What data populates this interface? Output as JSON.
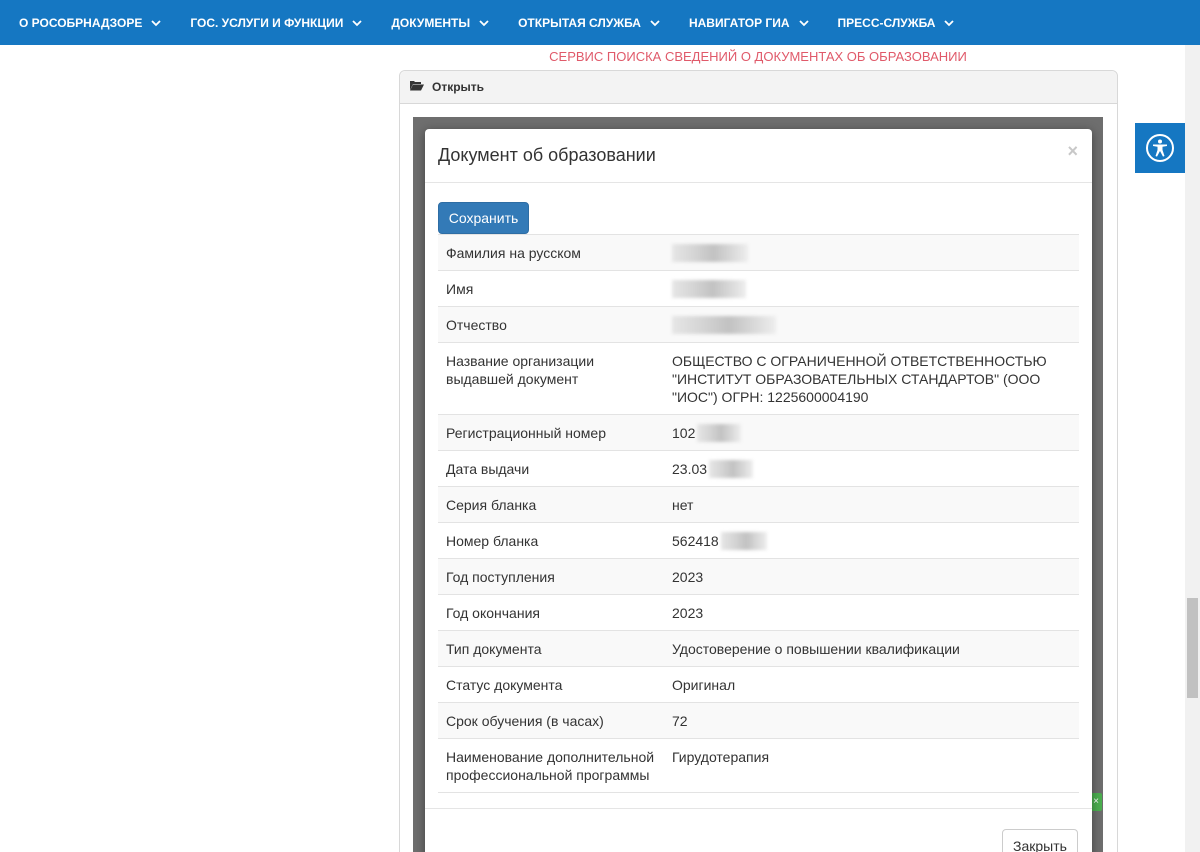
{
  "nav": {
    "items": [
      {
        "label": "О РОСОБРНАДЗОРЕ"
      },
      {
        "label": "ГОС. УСЛУГИ И ФУНКЦИИ"
      },
      {
        "label": "ДОКУМЕНТЫ"
      },
      {
        "label": "ОТКРЫТАЯ СЛУЖБА"
      },
      {
        "label": "НАВИГАТОР ГИА"
      },
      {
        "label": "ПРЕСС-СЛУЖБА"
      }
    ]
  },
  "service_title": "СЕРВИС ПОИСКА СВЕДЕНИЙ О ДОКУМЕНТАХ ОБ ОБРАЗОВАНИИ",
  "panel": {
    "open_label": "Открыть"
  },
  "modal": {
    "title": "Документ об образовании",
    "close_symbol": "×",
    "save_label": "Сохранить",
    "close_label": "Закрыть",
    "rows": [
      {
        "label": "Фамилия на русском",
        "value": ""
      },
      {
        "label": "Имя",
        "value": ""
      },
      {
        "label": "Отчество",
        "value": ""
      },
      {
        "label": "Название организации выдавшей документ",
        "value": "ОБЩЕСТВО С ОГРАНИЧЕННОЙ ОТВЕТСТВЕННОСТЬЮ \"ИНСТИТУТ ОБРАЗОВАТЕЛЬНЫХ СТАНДАРТОВ\" (ООО \"ИОС\") ОГРН: 1225600004190"
      },
      {
        "label": "Регистрационный номер",
        "value": "102"
      },
      {
        "label": "Дата выдачи",
        "value": "23.03"
      },
      {
        "label": "Серия бланка",
        "value": "нет"
      },
      {
        "label": "Номер бланка",
        "value": "562418"
      },
      {
        "label": "Год поступления",
        "value": "2023"
      },
      {
        "label": "Год окончания",
        "value": "2023"
      },
      {
        "label": "Тип документа",
        "value": "Удостоверение о повышении квалификации"
      },
      {
        "label": "Статус документа",
        "value": "Оригинал"
      },
      {
        "label": "Срок обучения (в часах)",
        "value": "72"
      },
      {
        "label": "Наименование дополнительной профессиональной программы",
        "value": "Гирудотерапия"
      }
    ]
  },
  "colors": {
    "nav_bg": "#1577c2",
    "service_title": "#e05a6a",
    "primary_button": "#337ab7"
  },
  "icons": {
    "nav_chevron": "chevron-down-icon",
    "panel_folder": "folder-open-icon",
    "accessibility": "accessibility-icon"
  }
}
